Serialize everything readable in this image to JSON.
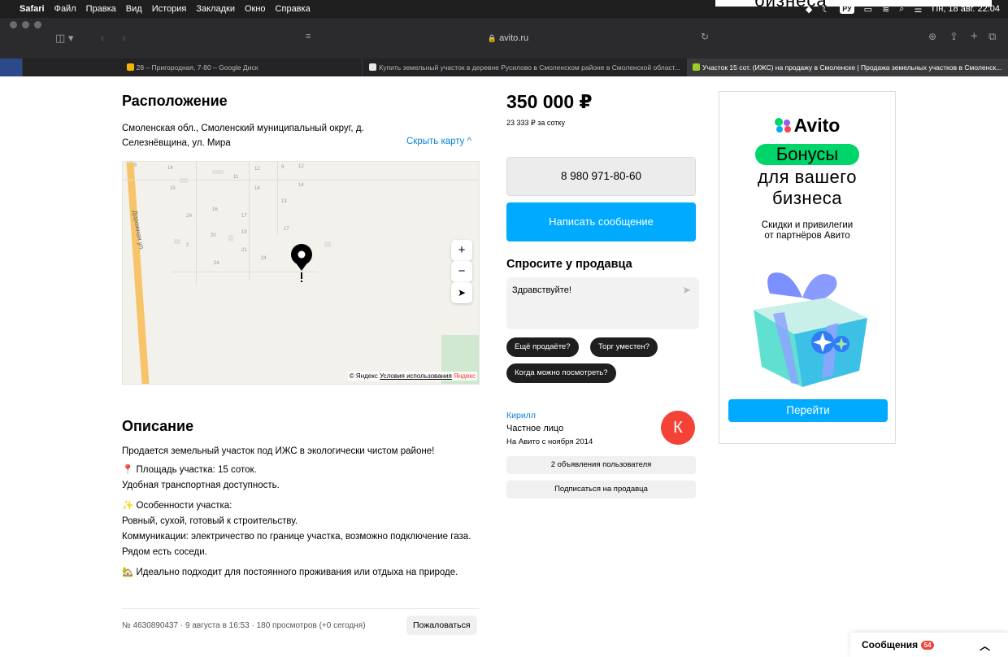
{
  "menubar": {
    "app": "Safari",
    "items": [
      "Файл",
      "Правка",
      "Вид",
      "История",
      "Закладки",
      "Окно",
      "Справка"
    ],
    "input_source": "РУ",
    "clock": "Пн, 18 авг. 22:04"
  },
  "peek_text": "бизнеса",
  "browser": {
    "url": "avito.ru"
  },
  "tabs": [
    {
      "label": "28 – Пригородная, 7-80 – Google Диск",
      "favicon_color": "#f4b400"
    },
    {
      "label": "Купить земельный участок в деревне Русилово в Смоленском районе в Смоленской област...",
      "favicon_color": "#e6e6e6"
    },
    {
      "label": "Участок 15 сот. (ИЖС) на продажу в Смоленске | Продажа земельных участков в Смоленск...",
      "favicon_color": "#97cf26"
    }
  ],
  "location": {
    "title": "Расположение",
    "address": "Смоленская обл., Смоленский муниципальный округ, д. Селезнёвщина, ул. Мира",
    "hide_map": "Скрыть карту ^",
    "street_label": "Дорожная ул.",
    "map_copyright": "© Яндекс",
    "map_terms": "Условия использования",
    "map_brand": "Яндекс",
    "house_numbers": [
      "14",
      "12",
      "9",
      "12",
      "11",
      "14",
      "15",
      "14",
      "13",
      "16",
      "17",
      "2А",
      "17",
      "20",
      "19",
      "2",
      "21",
      "24",
      "24"
    ]
  },
  "description": {
    "title": "Описание",
    "paragraphs": [
      "Продается земельный участок под ИЖС в экологически чистом районе!",
      "📍 Площадь участка: 15 соток.",
      "Удобная транспортная доступность.",
      "✨ Особенности участка:",
      "Ровный, сухой, готовый к строительству.",
      "Коммуникации: электричество по границе участка, возможно подключение газа. Рядом есть соседи.",
      "🏡 Идеально подходит для постоянного проживания или отдыха на природе."
    ],
    "meta": "№ 4630890437 · 9 августа в 16:53 · 180 просмотров (+0 сегодня)",
    "report_button": "Пожаловаться"
  },
  "listing": {
    "price": "350 000 ₽",
    "price_per_hundred": "23 333 ₽ за сотку",
    "phone": "8 980 971-80-60",
    "message_button": "Написать сообщение",
    "ask_title": "Спросите у продавца",
    "ask_text": "Здравствуйте!",
    "chips": [
      "Ещё продаёте?",
      "Торг уместен?",
      "Когда можно посмотреть?"
    ]
  },
  "seller": {
    "name": "Кирилл",
    "type": "Частное лицо",
    "since": "На Авито с ноября 2014",
    "avatar_letter": "К",
    "listings_button": "2 объявления пользователя",
    "subscribe_button": "Подписаться на продавца"
  },
  "ad": {
    "brand": "Avito",
    "line1": "Бонусы",
    "line2": "для вашего",
    "line3": "бизнеса",
    "subtitle1": "Скидки и привилегии",
    "subtitle2": "от партнёров Авито",
    "button": "Перейти"
  },
  "messages": {
    "label": "Сообщения",
    "count": "54"
  },
  "colors": {
    "accent": "#00aaff",
    "link": "#0a84d6",
    "avatar": "#f44336",
    "ad_green": "#00d56a"
  }
}
